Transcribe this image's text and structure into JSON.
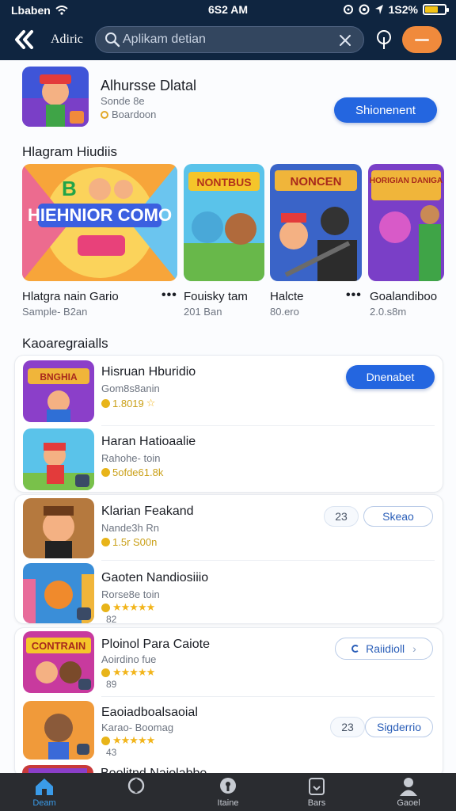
{
  "status": {
    "carrier": "Lbaben",
    "time": "6S2 AM",
    "battery": "1S2%"
  },
  "header": {
    "title": "Adiric",
    "search_placeholder": "Aplikam detian"
  },
  "featured": {
    "title": "Alhursse Dlatal",
    "subtitle": "Sonde 8e",
    "meta": "Boardoon",
    "button": "Shionenent"
  },
  "section1": {
    "title": "Hlagram Hiudiis",
    "items": [
      {
        "label": "Hlatgra nain Gario",
        "size": "Sample- B2an"
      },
      {
        "label": "Fouisky tam",
        "size": "201 Ban"
      },
      {
        "label": "Halcte",
        "size": "80.ero"
      },
      {
        "label": "Goalandiboo",
        "size": "2.0.s8m"
      }
    ],
    "thumbs": [
      {
        "art": "HIEHNIOR COMO",
        "top": "B"
      },
      {
        "art": "NONTBUS"
      },
      {
        "art": "NONCEN"
      },
      {
        "art": "HORIGIAN DANIGA"
      }
    ]
  },
  "section2": {
    "title": "Kaoaregraialls",
    "rows": [
      {
        "title": "Hisruan Hburidio",
        "sub": "Gom8s8anin",
        "rating": "1.8019",
        "button": "Dnenabet",
        "art": "BNGHIA"
      },
      {
        "title": "Haran Hatioaalie",
        "sub": "Rahohe- toin",
        "rating": "5ofde61.8k"
      },
      {
        "title": "Klarian Feakand",
        "sub": "Nande3h Rn",
        "rating": "1.5r S00n",
        "count": "23",
        "button": "Skeao"
      },
      {
        "title": "Gaoten Nandiosiiio",
        "sub": "Rorse8e toin",
        "rating": "",
        "extra": "82"
      },
      {
        "title": "Ploinol Para Caiote",
        "sub": "Aoirdino fue",
        "rating": "",
        "extra": "89",
        "button": "Raiidioll",
        "art": "CONTRAIN"
      },
      {
        "title": "Eaoiadboalsaoial",
        "sub": "Karao- Boomag",
        "rating": "",
        "extra": "43",
        "count": "23",
        "button": "Sigderrio"
      },
      {
        "title": "Boolitnd Naiolabbe"
      }
    ]
  },
  "bottom_nav": [
    {
      "label": "Deam",
      "icon": "home-icon"
    },
    {
      "label": "",
      "icon": "games-icon"
    },
    {
      "label": "Itaine",
      "icon": "apps-icon"
    },
    {
      "label": "Bars",
      "icon": "updates-icon"
    },
    {
      "label": "Gaoel",
      "icon": "profile-icon"
    }
  ],
  "colors": {
    "header": "#0f2540",
    "accent": "#2466e0",
    "orange": "#f08a3c",
    "nav": "#2a2c30",
    "nav_active": "#3a9be8"
  }
}
